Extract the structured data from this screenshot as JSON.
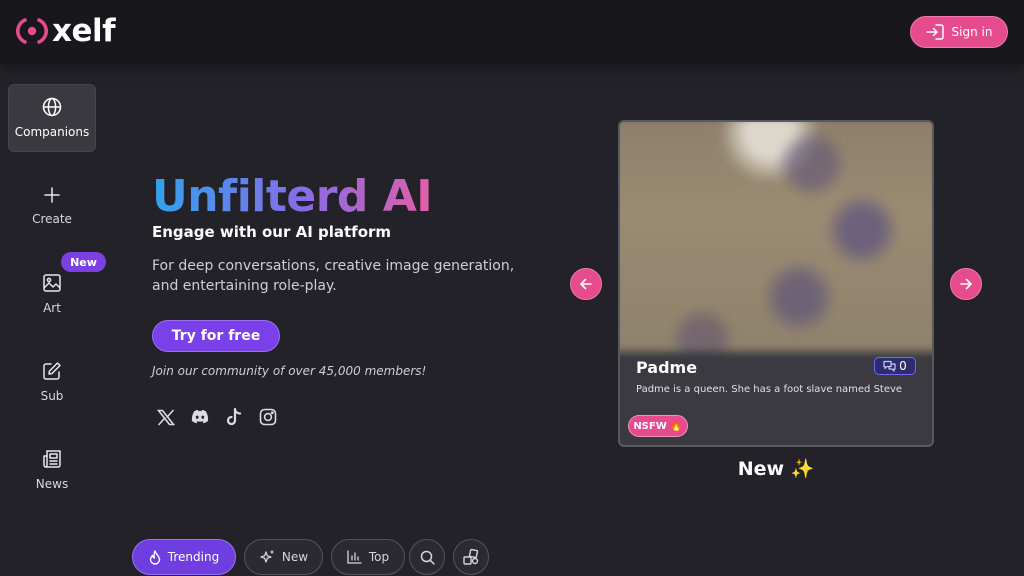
{
  "header": {
    "brand": "xelf",
    "signin_label": "Sign in",
    "logo_color": "#e64b8e"
  },
  "sidebar": {
    "items": [
      {
        "label": "Companions",
        "icon": "globe-icon",
        "active": true
      },
      {
        "label": "Create",
        "icon": "plus-icon"
      },
      {
        "label": "Art",
        "icon": "image-icon",
        "badge": "New"
      },
      {
        "label": "Sub",
        "icon": "edit-icon"
      },
      {
        "label": "News",
        "icon": "newspaper-icon"
      }
    ]
  },
  "hero": {
    "title": "Unfilterd AI",
    "subtitle": "Engage with our AI platform",
    "description": "For deep conversations, creative image generation, and entertaining role-play.",
    "cta_label": "Try for free",
    "community_text": "Join our community of over 45,000 members!",
    "socials": [
      "x-icon",
      "discord-icon",
      "tiktok-icon",
      "instagram-icon"
    ]
  },
  "carousel": {
    "card": {
      "name": "Padme",
      "message_count": "0",
      "description": "Padme is a queen. She has a foot slave named Steve",
      "tag": "NSFW 🔥"
    },
    "label": "New ✨"
  },
  "filters": [
    {
      "label": "Trending",
      "icon": "flame-icon",
      "active": true
    },
    {
      "label": "New",
      "icon": "sparkles-icon"
    },
    {
      "label": "Top",
      "icon": "bar-chart-icon"
    },
    {
      "label": "",
      "icon": "search-icon"
    },
    {
      "label": "",
      "icon": "shapes-icon"
    }
  ],
  "colors": {
    "accent_pink": "#e64b8e",
    "accent_purple": "#7a40ea",
    "background": "#232228",
    "header": "#18171c"
  }
}
